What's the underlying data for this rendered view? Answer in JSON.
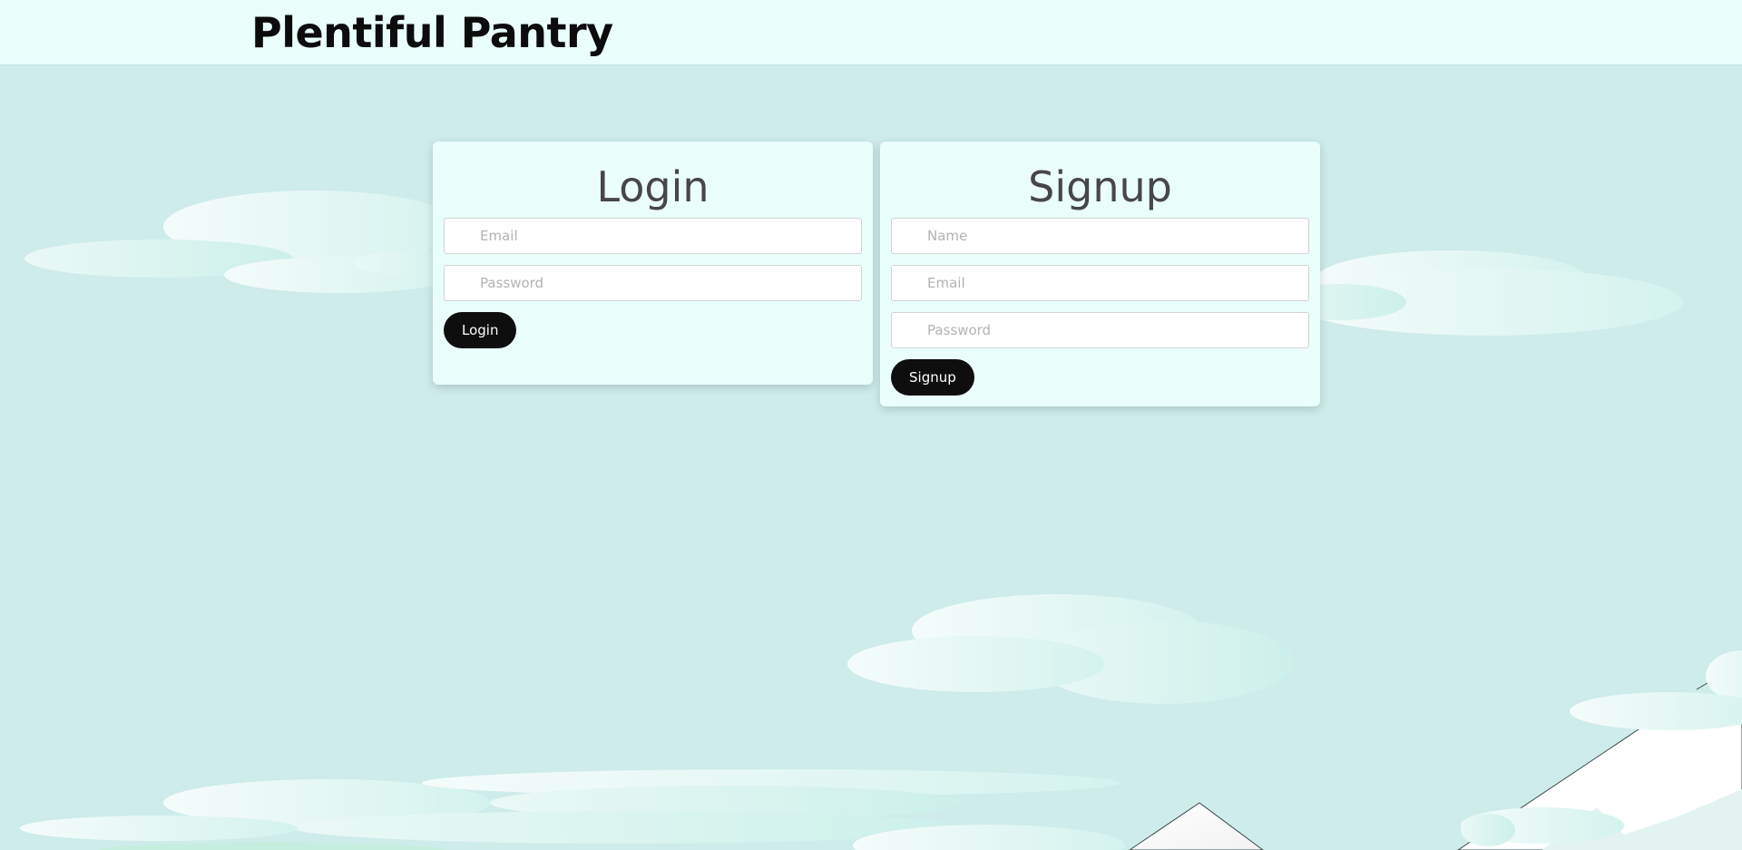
{
  "header": {
    "title": "Plentiful Pantry"
  },
  "login": {
    "title": "Login",
    "email_placeholder": "Email",
    "password_placeholder": "Password",
    "button_label": "Login"
  },
  "signup": {
    "title": "Signup",
    "name_placeholder": "Name",
    "email_placeholder": "Email",
    "password_placeholder": "Password",
    "button_label": "Signup"
  },
  "colors": {
    "page_background": "#cdecea",
    "header_background": "#eafffc",
    "card_background": "#eafffc",
    "button_background": "#0e0e0e",
    "button_text": "#ffffff",
    "title_text": "#0c0c0c",
    "card_title_text": "#474747"
  }
}
